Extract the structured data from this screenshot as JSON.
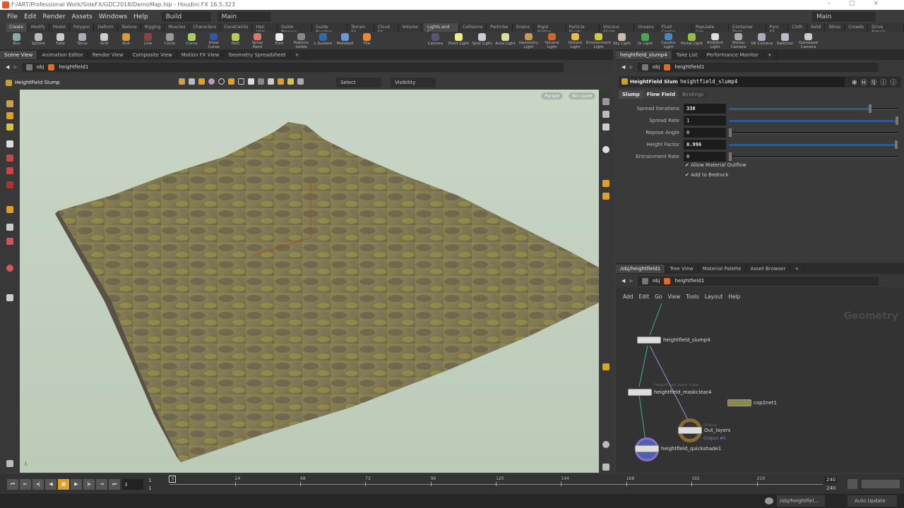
{
  "window": {
    "title": "F:/ART/Professional Work/SideFX/GDC2018/DemoMap.hip - Houdini FX 16.5.323",
    "controls": [
      "–",
      "□",
      "×"
    ]
  },
  "menu": {
    "items": [
      "File",
      "Edit",
      "Render",
      "Assets",
      "Windows",
      "Help"
    ],
    "desktop": "Build",
    "context": "Main",
    "right_desktop": "Main"
  },
  "shelf_left": {
    "tabs": [
      "Create",
      "Modify",
      "Model",
      "Polygon",
      "Deform",
      "Texture",
      "Rigging",
      "Muscles",
      "Characters",
      "Constraints",
      "Hair Utils",
      "Guide Process",
      "Guide Brushes",
      "Terrain FX",
      "Cloud FX",
      "Volume"
    ],
    "tools": [
      "Box",
      "Sphere",
      "Tube",
      "Torus",
      "Grid",
      "Null",
      "Line",
      "Circle",
      "Curve",
      "Draw Curve",
      "Path",
      "Spray Paint",
      "Font",
      "Platonic Solids",
      "L-System",
      "Metaball",
      "File"
    ]
  },
  "shelf_right": {
    "tabs": [
      "Lights and C...",
      "Collisions",
      "Particles",
      "Grains",
      "Rigid Bodies",
      "Particle Fluids",
      "Viscous Fluids",
      "Oceans",
      "Fluid Contai...",
      "Populate Con...",
      "Container Tools",
      "Pyro FX",
      "Cloth",
      "Solid",
      "Wires",
      "Crowds",
      "Drive Simula..."
    ],
    "tools": [
      "Camera",
      "Point Light",
      "Spot Light",
      "Area Light",
      "Geometry Light",
      "Volume Light",
      "Distant Light",
      "Environment Light",
      "Sky Light",
      "GI Light",
      "Caustic Light",
      "Portal Light",
      "Ambient Light",
      "Stereo Camera",
      "VR Camera",
      "Switcher",
      "Gamepad Camera"
    ]
  },
  "left_pane": {
    "tabs": [
      "Scene View",
      "Animation Editor",
      "Render View",
      "Composite View",
      "Motion FX View",
      "Geometry Spreadsheet"
    ],
    "path": [
      "obj",
      "heightfield1"
    ],
    "viewport_title": "HeightField Slump",
    "select": "Select",
    "visibility": "Visibility",
    "persp": "Persp▾",
    "cam": "No cam▾"
  },
  "param_pane": {
    "tabs": [
      "heightfield_slump4",
      "Take List",
      "Performance Monitor"
    ],
    "path": [
      "obj",
      "heightfield1"
    ],
    "node_type": "HeightField Slump",
    "node_name": "heightfield_slump4",
    "subtabs": [
      "Slump",
      "Flow Field",
      "Bindings"
    ],
    "params": [
      {
        "label": "Spread Iterations",
        "value": "338",
        "fraction": 0.84
      },
      {
        "label": "Spread Rate",
        "value": "1",
        "fraction": 1.0
      },
      {
        "label": "Repose Angle",
        "value": "0",
        "fraction": 0
      },
      {
        "label": "Height Factor",
        "value": "0.996",
        "fraction": 0.996
      },
      {
        "label": "Entrainment Rate",
        "value": "0",
        "fraction": 0
      }
    ],
    "checkboxes": [
      {
        "label": "Allow Material Outflow",
        "checked": true
      },
      {
        "label": "Add to Bedrock",
        "checked": true
      }
    ]
  },
  "network_pane": {
    "tabs": [
      "/obj/heightfield1",
      "Tree View",
      "Material Palette",
      "Asset Browser"
    ],
    "path": [
      "obj",
      "heightfield1"
    ],
    "menu": [
      "Add",
      "Edit",
      "Go",
      "View",
      "Tools",
      "Layout",
      "Help"
    ],
    "context_label": "Geometry",
    "nodes": {
      "slump": "heightfield_slump4",
      "maskclear": "heightfield_maskclear4",
      "maskclear_comment": "HeightField Layer Clear",
      "cop": "cop2net1",
      "out_type": "Output",
      "out": "Out_layers",
      "out_sub": "Output #0",
      "shade": "heightfield_quickshade1"
    }
  },
  "timeline": {
    "current_frame": "3",
    "start": "1",
    "start2": "1",
    "end": "240",
    "end2": "240",
    "ticks": [
      "24",
      "48",
      "72",
      "96",
      "120",
      "144",
      "168",
      "192",
      "216"
    ]
  },
  "status": {
    "path": "/obj/heightfiel...",
    "update": "Auto Update"
  },
  "colors": {
    "accent": "#e0a020",
    "viewport_bg": "#c5d3c1"
  }
}
